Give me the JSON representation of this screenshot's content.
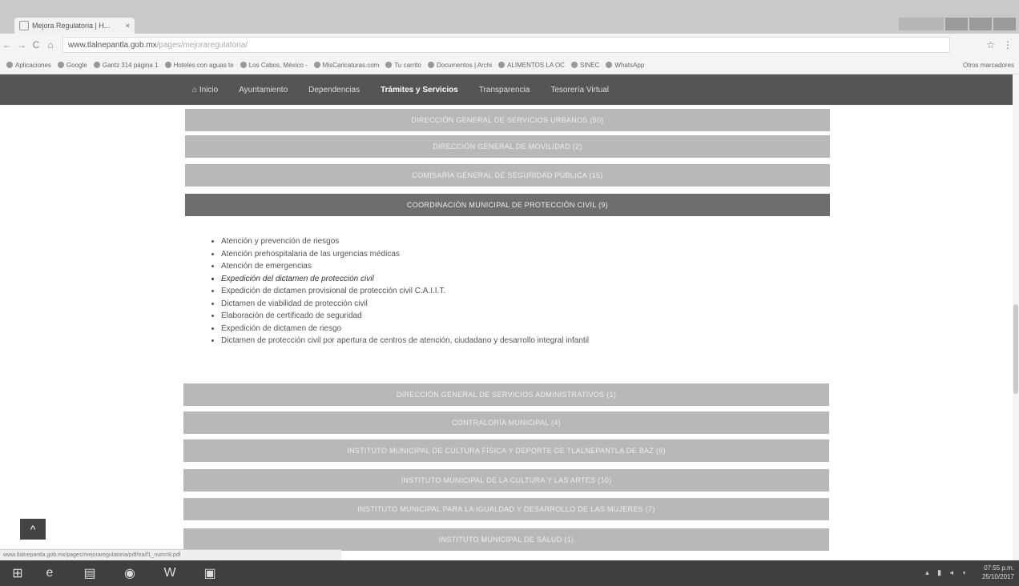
{
  "browser": {
    "tab_title": "Mejora Regulatoria | H...",
    "tab_close": "×",
    "back": "←",
    "forward": "→",
    "reload": "C",
    "home": "⌂",
    "url_host": "www.tlalnepantla.gob.mx",
    "url_path": "/pages/mejoraregulatoria/",
    "star": "☆",
    "menu": "⋮",
    "bookmarks": [
      {
        "label": "Aplicaciones"
      },
      {
        "label": "Google"
      },
      {
        "label": "Gantz 314 página 1"
      },
      {
        "label": "Hoteles con aguas te"
      },
      {
        "label": "Los Cabos, México -"
      },
      {
        "label": "MisCaricaturas.com"
      },
      {
        "label": "Tu carrito"
      },
      {
        "label": "Documentos | Archi"
      },
      {
        "label": "ALIMENTOS LA OC"
      },
      {
        "label": "SINEC"
      },
      {
        "label": "WhatsApp"
      }
    ],
    "other_bookmarks": "Otros marcadores"
  },
  "site_nav": {
    "items": [
      {
        "label": "⌂ Inicio",
        "active": false
      },
      {
        "label": "Ayuntamiento",
        "active": false
      },
      {
        "label": "Dependencias",
        "active": false
      },
      {
        "label": "Trámites y Servicios",
        "active": true
      },
      {
        "label": "Transparencia",
        "active": false
      },
      {
        "label": "Tesorería Virtual",
        "active": false
      }
    ]
  },
  "accordion_top": [
    {
      "label": "DIRECCIÓN GENERAL DE SERVICIOS URBANOS (50)"
    },
    {
      "label": "DIRECCIÓN GENERAL DE MOVILIDAD (2)"
    },
    {
      "label": "COMISARÍA GENERAL DE SEGURIDAD PÚBLICA (15)"
    },
    {
      "label": "COORDINACIÓN MUNICIPAL DE PROTECCIÓN CIVIL (9)",
      "expanded": true
    }
  ],
  "expanded_items": [
    "Atención y prevención de riesgos",
    "Atención prehospitalaria de las urgencias médicas",
    "Atención de emergencias",
    "Expedición del dictamen de protección civil",
    "Expedición de dictamen provisional de protección civil C.A.I.I.T.",
    "Dictamen de viabilidad de protección civil",
    "Elaboración de certificado de seguridad",
    "Expedición de dictamen de riesgo",
    "Dictamen de protección civil por apertura de centros de atención, ciudadano y desarrollo integral infantil"
  ],
  "accordion_bottom": [
    {
      "label": "DIRECCIÓN GENERAL DE SERVICIOS ADMINISTRATIVOS (1)"
    },
    {
      "label": "CONTRALORÍA MUNICIPAL (4)"
    },
    {
      "label": "INSTITUTO MUNICIPAL DE CULTURA FÍSICA Y DEPORTE DE TLALNEPANTLA DE BAZ (8)"
    },
    {
      "label": "INSTITUTO MUNICIPAL DE LA CULTURA Y LAS ARTES (10)"
    },
    {
      "label": "INSTITUTO MUNICIPAL PARA LA IGUALDAD Y DESARROLLO DE LAS MUJERES (7)"
    },
    {
      "label": "INSTITUTO MUNICIPAL DE SALUD (1)"
    }
  ],
  "back_to_top": "^",
  "status_url": "www.tlalnepantla.gob.mx/pages/mejoraregulatoria/pdf/tra/f1_num=8.pdf",
  "clock": {
    "time": "07:55 p.m.",
    "date": "25/10/2017"
  },
  "colors": {
    "nav_bg": "#555555",
    "accordion": "#b8b8b8",
    "accordion_active": "#6e6e6e"
  }
}
